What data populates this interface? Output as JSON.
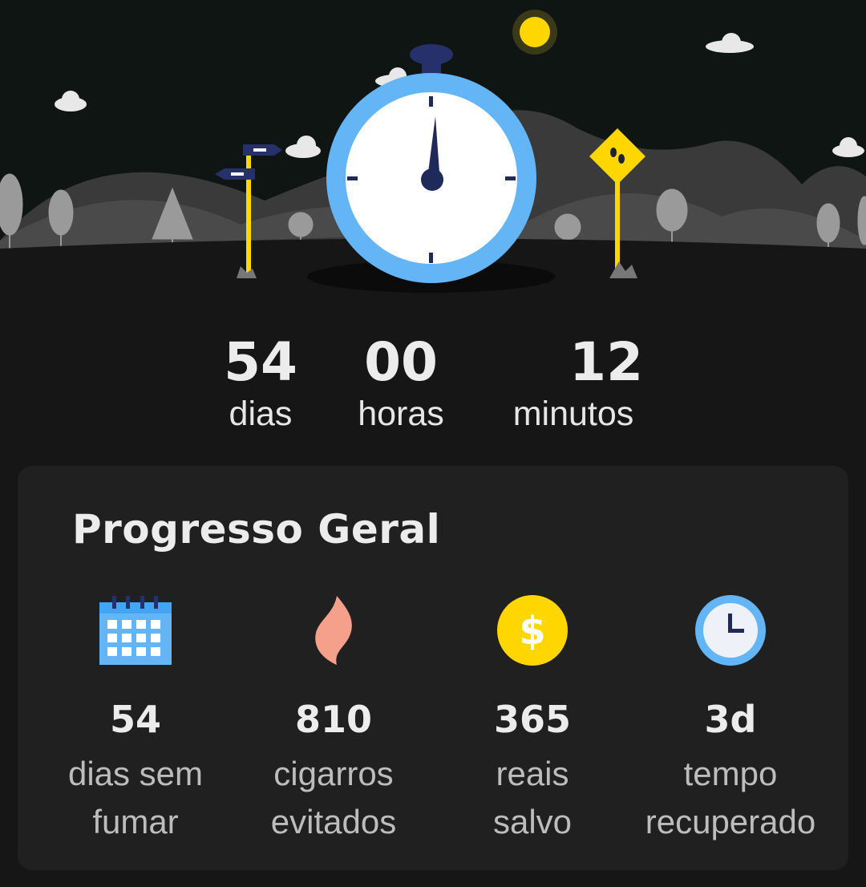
{
  "timer": {
    "days": {
      "value": "54",
      "label": "dias"
    },
    "hours": {
      "value": "00",
      "label": "horas"
    },
    "minutes": {
      "value": "12",
      "label": "minutos"
    }
  },
  "progress": {
    "title": "Progresso Geral",
    "stats": [
      {
        "icon": "calendar-icon",
        "value": "54",
        "line1": "dias sem",
        "line2": "fumar"
      },
      {
        "icon": "flame-icon",
        "value": "810",
        "line1": "cigarros",
        "line2": "evitados"
      },
      {
        "icon": "dollar-coin-icon",
        "value": "365",
        "line1": "reais",
        "line2": "salvo"
      },
      {
        "icon": "clock-icon",
        "value": "3d",
        "line1": "tempo",
        "line2": "recuperado"
      }
    ]
  },
  "colors": {
    "background": "#161616",
    "card": "#202020",
    "clock_ring": "#64b5f6",
    "clock_hand": "#1f2a5a",
    "sign_yellow": "#ffd600",
    "flame": "#f4a08a"
  }
}
